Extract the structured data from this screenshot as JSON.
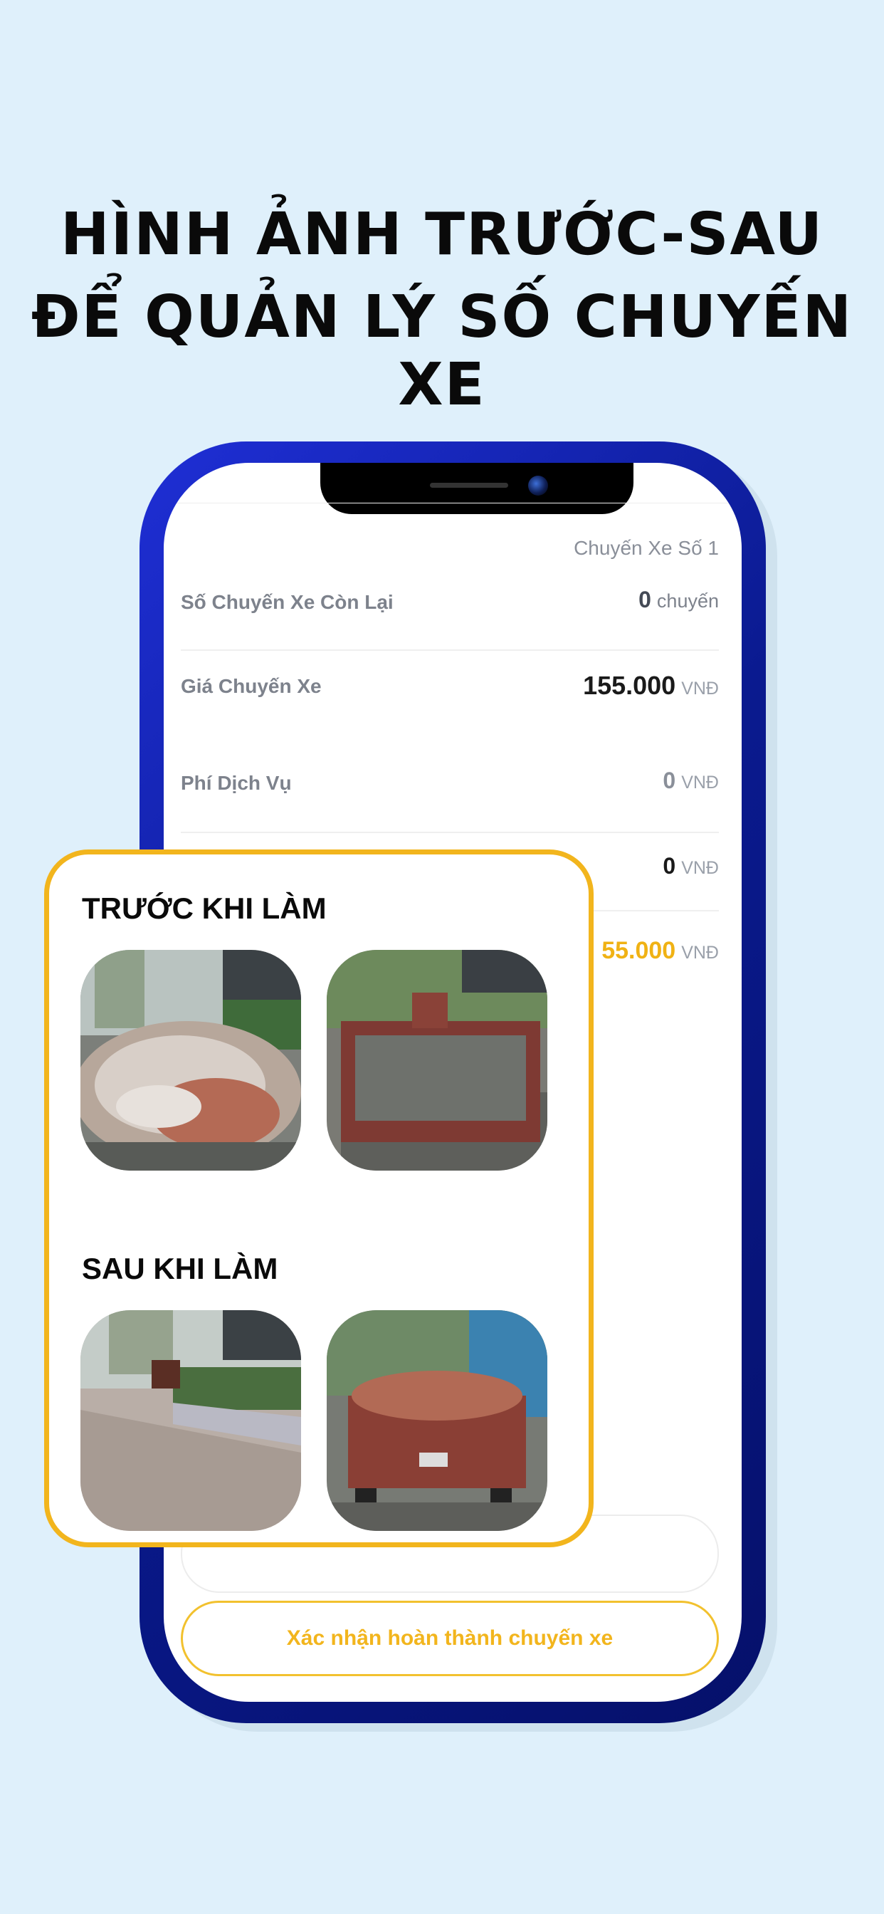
{
  "headline": {
    "line1": "HÌNH ẢNH TRƯỚC-SAU",
    "line2": "ĐỂ QUẢN LÝ SỐ CHUYẾN XE"
  },
  "screen": {
    "trip_number": "Chuyến Xe Số 1",
    "rows": [
      {
        "label": "Số Chuyến Xe Còn Lại",
        "value": "0",
        "unit": "chuyến"
      },
      {
        "label": "Giá Chuyến Xe",
        "value": "155.000",
        "unit": "VNĐ"
      },
      {
        "label": "Phí Dịch Vụ",
        "value": "0",
        "unit": "VNĐ"
      },
      {
        "label": "",
        "value": "0",
        "unit": "VNĐ"
      },
      {
        "label": "",
        "value": "55.000",
        "unit": "VNĐ"
      }
    ],
    "confirm_button": "Xác nhận hoàn thành chuyến xe"
  },
  "overlay": {
    "before_title": "TRƯỚC KHI LÀM",
    "after_title": "SAU KHI LÀM"
  },
  "colors": {
    "background": "#dff0fb",
    "accent_gold": "#f2b51d",
    "phone_frame": "#0a1a8f"
  },
  "icons": [
    "camera-icon",
    "speaker-icon"
  ]
}
